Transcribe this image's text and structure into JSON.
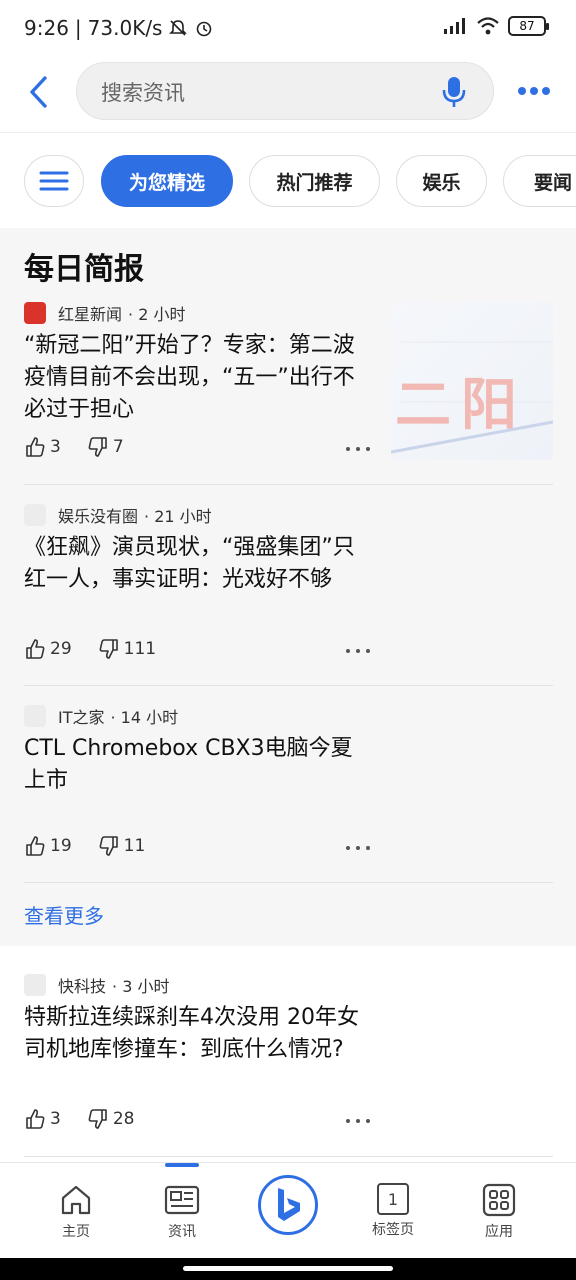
{
  "status": {
    "time": "9:26",
    "speed": "73.0K/s",
    "battery": "87"
  },
  "search": {
    "placeholder": "搜索资讯"
  },
  "tabs": [
    {
      "label": "为您精选"
    },
    {
      "label": "热门推荐"
    },
    {
      "label": "娱乐"
    },
    {
      "label": "要闻"
    }
  ],
  "brief": {
    "title": "每日简报",
    "see_more": "查看更多",
    "articles": [
      {
        "source": "红星新闻",
        "time": "· 2 小时",
        "headline": "“新冠二阳”开始了？专家：第二波疫情目前不会出现，“五一”出行不必过于担心",
        "likes": "3",
        "dislikes": "7",
        "thumb_text": "二阳"
      },
      {
        "source": "娱乐没有圈",
        "time": "· 21 小时",
        "headline": "《狂飙》演员现状，“强盛集团”只红一人，事实证明：光戏好不够",
        "likes": "29",
        "dislikes": "111"
      },
      {
        "source": "IT之家",
        "time": "· 14 小时",
        "headline": "CTL Chromebox CBX3电脑今夏上市",
        "likes": "19",
        "dislikes": "11"
      }
    ]
  },
  "feed": {
    "articles": [
      {
        "source": "快科技",
        "time": "· 3 小时",
        "headline": "特斯拉连续踩刹车4次没用 20年女司机地库惨撞车：到底什么情况?",
        "likes": "3",
        "dislikes": "28"
      }
    ]
  },
  "nav": {
    "home": "主页",
    "news": "资讯",
    "tabs_label": "标签页",
    "tabs_count": "1",
    "apps": "应用"
  },
  "colors": {
    "accent": "#2f6fe4",
    "brief_bg": "#f6f6f6"
  }
}
